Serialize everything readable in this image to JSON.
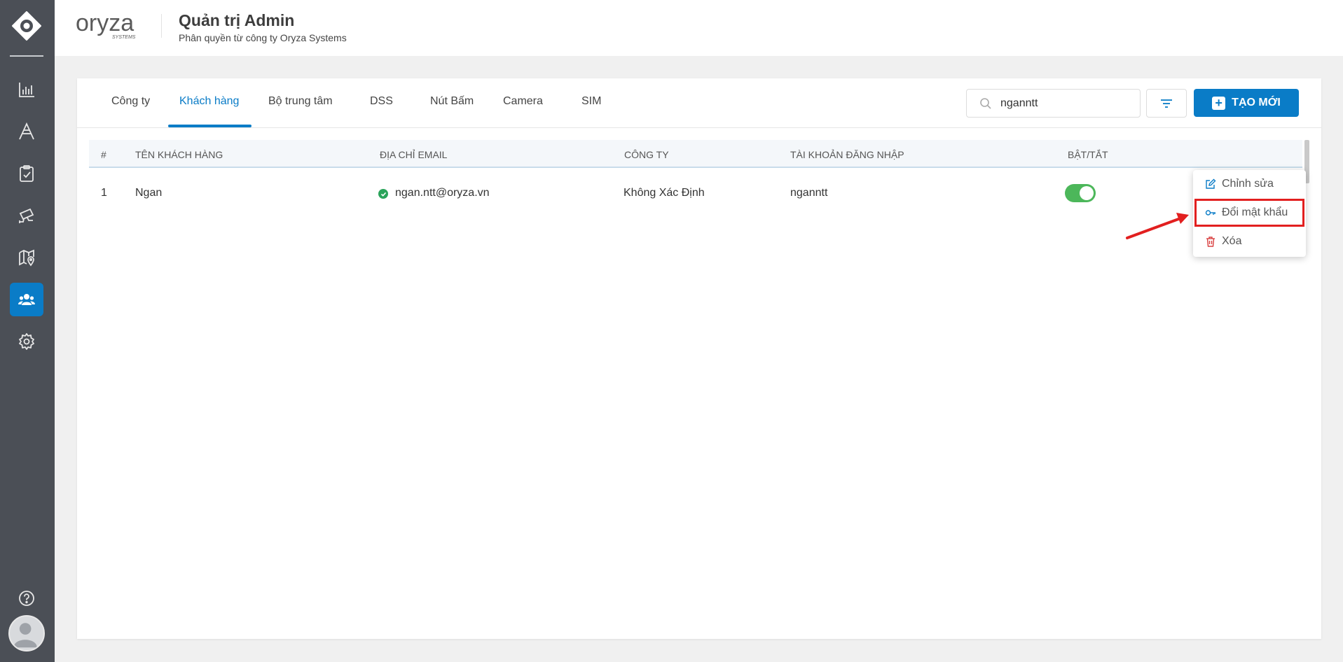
{
  "header": {
    "brand_text": "oryza",
    "brand_sub": "SYSTEMS",
    "title": "Quản trị Admin",
    "subtitle": "Phân quyền từ công ty Oryza Systems"
  },
  "sidebar": {
    "items": [
      {
        "icon": "bar-chart-icon"
      },
      {
        "icon": "letter-a-icon"
      },
      {
        "icon": "clipboard-check-icon"
      },
      {
        "icon": "cctv-camera-icon"
      },
      {
        "icon": "map-pin-icon"
      },
      {
        "icon": "users-icon",
        "active": true
      },
      {
        "icon": "gear-icon"
      }
    ],
    "help_icon": "help-circle-icon",
    "avatar_icon": "user-avatar-icon"
  },
  "tabs": [
    {
      "label": "Công ty"
    },
    {
      "label": "Khách hàng",
      "active": true
    },
    {
      "label": "Bộ trung tâm"
    },
    {
      "label": "DSS"
    },
    {
      "label": "Nút Bấm"
    },
    {
      "label": "Camera"
    },
    {
      "label": "SIM"
    }
  ],
  "toolbar": {
    "search_value": "nganntt",
    "create_label": "TẠO MỚI"
  },
  "table": {
    "headers": [
      "#",
      "TÊN KHÁCH HÀNG",
      "ĐỊA CHỈ EMAIL",
      "CÔNG TY",
      "TÀI KHOẢN ĐĂNG NHẬP",
      "BẬT/TẮT"
    ],
    "rows": [
      {
        "index": "1",
        "name": "Ngan",
        "email": "ngan.ntt@oryza.vn",
        "company": "Không Xác Định",
        "login": "nganntt",
        "enabled": true
      }
    ]
  },
  "context_menu": {
    "items": [
      {
        "label": "Chỉnh sửa",
        "icon": "edit-icon"
      },
      {
        "label": "Đổi mật khẩu",
        "icon": "key-icon",
        "highlighted": true
      },
      {
        "label": "Xóa",
        "icon": "trash-icon"
      }
    ]
  },
  "colors": {
    "sidebar_bg": "#4b4f56",
    "accent": "#0a7cc7",
    "toggle_on": "#4cb75a",
    "highlight": "#e21f1f",
    "delete": "#d94040"
  }
}
